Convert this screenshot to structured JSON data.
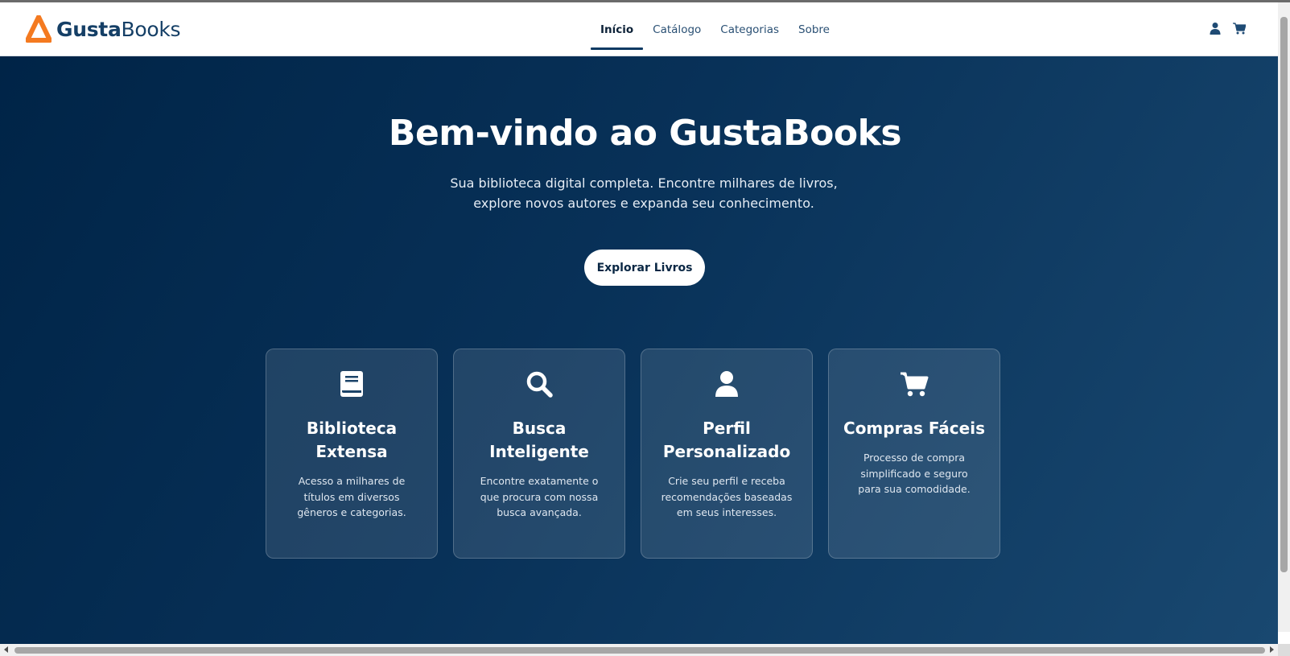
{
  "brand": {
    "bold": "Gusta",
    "regular": "Books",
    "accent_color": "#f47a20",
    "text_color": "#153f66"
  },
  "nav": {
    "items": [
      {
        "label": "Início",
        "active": true
      },
      {
        "label": "Catálogo",
        "active": false
      },
      {
        "label": "Categorias",
        "active": false
      },
      {
        "label": "Sobre",
        "active": false
      }
    ]
  },
  "header_icons": [
    "user-icon",
    "cart-icon"
  ],
  "hero": {
    "title": "Bem-vindo ao GustaBooks",
    "subtitle": "Sua biblioteca digital completa. Encontre milhares de livros, explore novos autores e expanda seu conhecimento.",
    "cta_label": "Explorar Livros",
    "background_colors": [
      "#002447",
      "#194870"
    ]
  },
  "features": [
    {
      "icon": "book-icon",
      "title": "Biblioteca Extensa",
      "description": "Acesso a milhares de títulos em diversos gêneros e categorias."
    },
    {
      "icon": "search-icon",
      "title": "Busca Inteligente",
      "description": "Encontre exatamente o que procura com nossa busca avançada."
    },
    {
      "icon": "user-icon",
      "title": "Perfil Personalizado",
      "description": "Crie seu perfil e receba recomendações baseadas em seus interesses."
    },
    {
      "icon": "cart-icon",
      "title": "Compras Fáceis",
      "description": "Processo de compra simplificado e seguro para sua comodidade."
    }
  ]
}
